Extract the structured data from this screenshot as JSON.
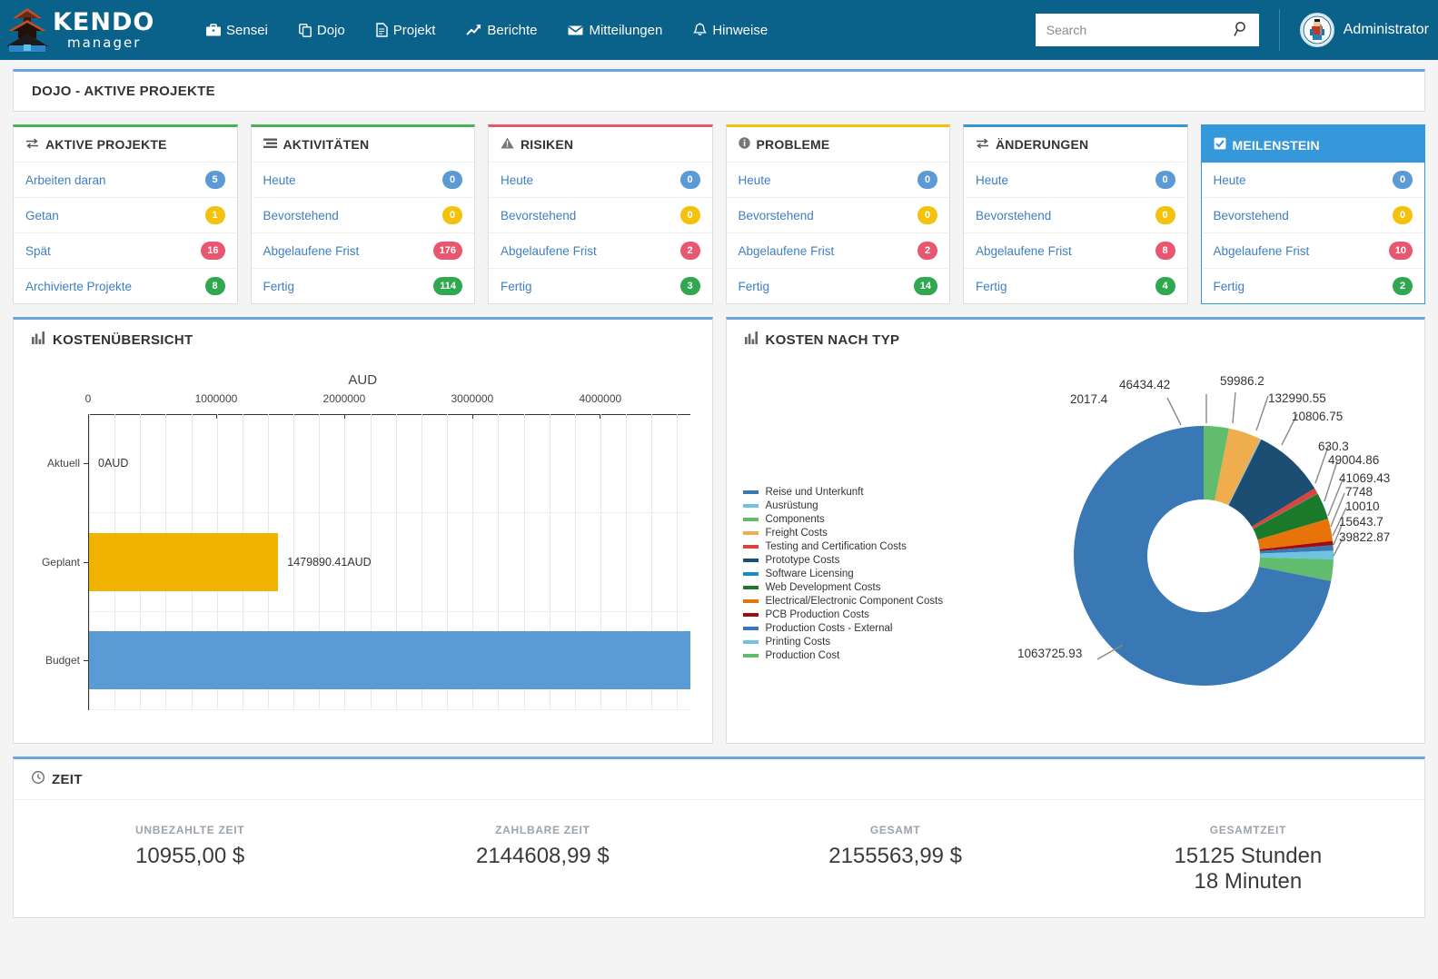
{
  "brand": {
    "name_top": "KENDO",
    "name_bottom": "manager"
  },
  "nav": {
    "items": [
      {
        "label": "Sensei",
        "icon": "briefcase-icon"
      },
      {
        "label": "Dojo",
        "icon": "copy-icon"
      },
      {
        "label": "Projekt",
        "icon": "file-icon"
      },
      {
        "label": "Berichte",
        "icon": "chart-line-icon"
      },
      {
        "label": "Mitteilungen",
        "icon": "envelope-icon"
      },
      {
        "label": "Hinweise",
        "icon": "bell-icon"
      }
    ]
  },
  "search": {
    "placeholder": "Search",
    "value": "",
    "icon": "search-icon"
  },
  "user": {
    "name": "Administrator",
    "avatar_icon": "samurai-avatar-icon"
  },
  "page": {
    "title": "DOJO - AKTIVE PROJEKTE"
  },
  "cards": [
    {
      "title": "AKTIVE PROJEKTE",
      "icon": "exchange-icon",
      "accent": "#4caf50",
      "selected": false,
      "rows": [
        {
          "label": "Arbeiten daran",
          "value": "5",
          "color": "b-blue"
        },
        {
          "label": "Getan",
          "value": "1",
          "color": "b-yellow"
        },
        {
          "label": "Spät",
          "value": "16",
          "color": "b-red"
        },
        {
          "label": "Archivierte Projekte",
          "value": "8",
          "color": "b-green"
        }
      ]
    },
    {
      "title": "AKTIVITÄTEN",
      "icon": "tasks-icon",
      "accent": "#4caf50",
      "selected": false,
      "rows": [
        {
          "label": "Heute",
          "value": "0",
          "color": "b-blue"
        },
        {
          "label": "Bevorstehend",
          "value": "0",
          "color": "b-yellow"
        },
        {
          "label": "Abgelaufene Frist",
          "value": "176",
          "color": "b-red"
        },
        {
          "label": "Fertig",
          "value": "114",
          "color": "b-green"
        }
      ]
    },
    {
      "title": "RISIKEN",
      "icon": "warning-icon",
      "accent": "#e8566f",
      "selected": false,
      "rows": [
        {
          "label": "Heute",
          "value": "0",
          "color": "b-blue"
        },
        {
          "label": "Bevorstehend",
          "value": "0",
          "color": "b-yellow"
        },
        {
          "label": "Abgelaufene Frist",
          "value": "2",
          "color": "b-red"
        },
        {
          "label": "Fertig",
          "value": "3",
          "color": "b-green"
        }
      ]
    },
    {
      "title": "PROBLEME",
      "icon": "info-icon",
      "accent": "#f4c20d",
      "selected": false,
      "rows": [
        {
          "label": "Heute",
          "value": "0",
          "color": "b-blue"
        },
        {
          "label": "Bevorstehend",
          "value": "0",
          "color": "b-yellow"
        },
        {
          "label": "Abgelaufene Frist",
          "value": "2",
          "color": "b-red"
        },
        {
          "label": "Fertig",
          "value": "14",
          "color": "b-green"
        }
      ]
    },
    {
      "title": "ÄNDERUNGEN",
      "icon": "exchange-icon",
      "accent": "#3498db",
      "selected": false,
      "rows": [
        {
          "label": "Heute",
          "value": "0",
          "color": "b-blue"
        },
        {
          "label": "Bevorstehend",
          "value": "0",
          "color": "b-yellow"
        },
        {
          "label": "Abgelaufene Frist",
          "value": "8",
          "color": "b-red"
        },
        {
          "label": "Fertig",
          "value": "4",
          "color": "b-green"
        }
      ]
    },
    {
      "title": "MEILENSTEIN",
      "icon": "checkbox-icon",
      "accent": "#3498db",
      "selected": true,
      "rows": [
        {
          "label": "Heute",
          "value": "0",
          "color": "b-blue"
        },
        {
          "label": "Bevorstehend",
          "value": "0",
          "color": "b-yellow"
        },
        {
          "label": "Abgelaufene Frist",
          "value": "10",
          "color": "b-red"
        },
        {
          "label": "Fertig",
          "value": "2",
          "color": "b-green"
        }
      ]
    }
  ],
  "cost_overview": {
    "title": "KOSTENÜBERSICHT",
    "icon": "bar-chart-icon"
  },
  "cost_by_type": {
    "title": "KOSTEN NACH TYP",
    "icon": "bar-chart-icon"
  },
  "zeit": {
    "title": "ZEIT",
    "icon": "clock-icon",
    "columns": [
      {
        "label": "UNBEZAHLTE ZEIT",
        "value": "10955,00 $"
      },
      {
        "label": "ZAHLBARE ZEIT",
        "value": "2144608,99 $"
      },
      {
        "label": "GESAMT",
        "value": "2155563,99 $"
      },
      {
        "label": "GESAMTZEIT",
        "value": "15125 Stunden\n18 Minuten"
      }
    ]
  },
  "chart_data": [
    {
      "type": "bar",
      "orientation": "horizontal",
      "title": "AUD",
      "xlabel": "",
      "ylabel": "",
      "categories": [
        "Aktuell",
        "Geplant",
        "Budget"
      ],
      "values": [
        0,
        1479890.41,
        4700000
      ],
      "data_labels": [
        "0AUD",
        "1479890.41AUD",
        ""
      ],
      "colors": [
        "#5b9bd5",
        "#f0b400",
        "#5b9bd5"
      ],
      "xlim": [
        0,
        4700000
      ],
      "xticks": [
        0,
        1000000,
        2000000,
        3000000,
        4000000
      ],
      "xticklabels": [
        "0",
        "1000000",
        "2000000",
        "3000000",
        "4000000"
      ],
      "grid": true,
      "legend": "none"
    },
    {
      "type": "pie",
      "subtype": "donut",
      "title": "KOSTEN NACH TYP",
      "legend": "left",
      "labels": [
        "Reise und Unterkunft",
        "Ausrüstung",
        "Components",
        "Freight Costs",
        "Testing and Certification Costs",
        "Prototype Costs",
        "Software Licensing",
        "Web Development Costs",
        "Electrical/Electronic Component Costs",
        "PCB Production Costs",
        "Production Costs - External",
        "Printing Costs",
        "Production Cost"
      ],
      "values": [
        1063725.93,
        2017.4,
        46434.42,
        59986.2,
        10806.75,
        132990.55,
        630.3,
        49004.86,
        41069.43,
        7748,
        10010,
        15643.7,
        39822.87
      ],
      "value_labels": [
        "1063725.93",
        "2017.4",
        "46434.42",
        "59986.2",
        "10806.75",
        "132990.55",
        "630.3",
        "49004.86",
        "41069.43",
        "7748",
        "10010",
        "15643.7",
        "39822.87"
      ],
      "colors": [
        "#3a78b5",
        "#6ec4e0",
        "#61b martin",
        "#f0ad4e",
        "#d9453d",
        "#1b4e72",
        "#1a8cc0",
        "#1b7a2a",
        "#e8730b",
        "#9c0d0d",
        "#3a78b5",
        "#6ec4e0",
        "#61bd6d"
      ]
    }
  ]
}
